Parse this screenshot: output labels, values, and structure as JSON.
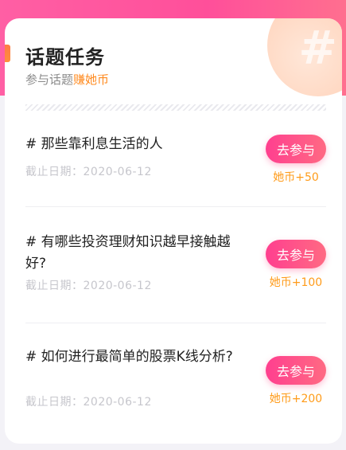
{
  "header": {
    "title": "话题任务",
    "subtitle_prefix": "参与话题",
    "subtitle_highlight": "赚她币",
    "corner_symbol": "#"
  },
  "topics": [
    {
      "title": "# 那些靠利息生活的人",
      "date": "截止日期：2020-06-12",
      "button_label": "去参与",
      "reward": "她币+50"
    },
    {
      "title": "# 有哪些投资理财知识越早接触越好?",
      "date": "截止日期：2020-06-12",
      "button_label": "去参与",
      "reward": "她币+100"
    },
    {
      "title": "# 如何进行最简单的股票K线分析?",
      "date": "截止日期：2020-06-12",
      "button_label": "去参与",
      "reward": "她币+200"
    }
  ],
  "colors": {
    "brand_pink": "#ff4f9a",
    "accent_orange": "#ff8a1f",
    "reward_orange": "#ff9b1a"
  }
}
